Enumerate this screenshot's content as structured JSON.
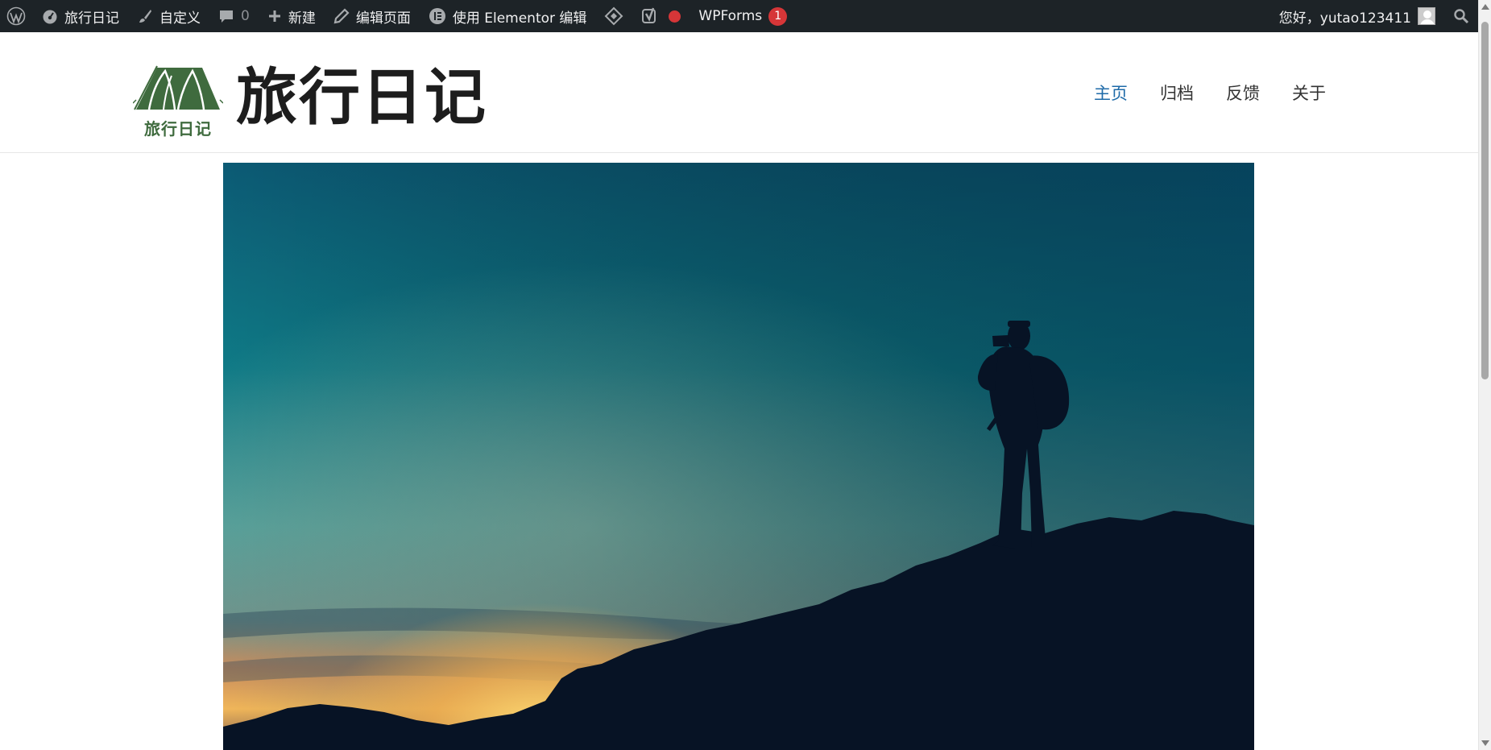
{
  "admin_bar": {
    "site_name": "旅行日记",
    "customize": "自定义",
    "comments_count": "0",
    "new": "新建",
    "edit_page": "编辑页面",
    "elementor_edit": "使用 Elementor 编辑",
    "wpforms": "WPForms",
    "wpforms_badge": "1",
    "greeting": "您好，yutao123411"
  },
  "site": {
    "logo_text": "旅行日记",
    "title": "旅行日记",
    "nav": [
      {
        "label": "主页",
        "current": true
      },
      {
        "label": "归档",
        "current": false
      },
      {
        "label": "反馈",
        "current": false
      },
      {
        "label": "关于",
        "current": false
      }
    ]
  },
  "colors": {
    "admin_bar_bg": "#1d2327",
    "nav_active": "#1e6aa8",
    "logo_green": "#3f6b3e",
    "badge_red": "#d63638"
  },
  "icons": {
    "wp": "wordpress-logo-icon",
    "dashboard": "dashboard-gauge-icon",
    "customize": "paintbrush-icon",
    "comments": "comment-bubble-icon",
    "new": "plus-icon",
    "edit": "pencil-icon",
    "elementor": "elementor-icon",
    "diamond": "diamond-icon",
    "yoast": "yoast-icon",
    "status": "red-dot-icon",
    "search": "search-icon"
  },
  "hero": {
    "image": "hiker silhouette on mountain ridge at sunset"
  }
}
